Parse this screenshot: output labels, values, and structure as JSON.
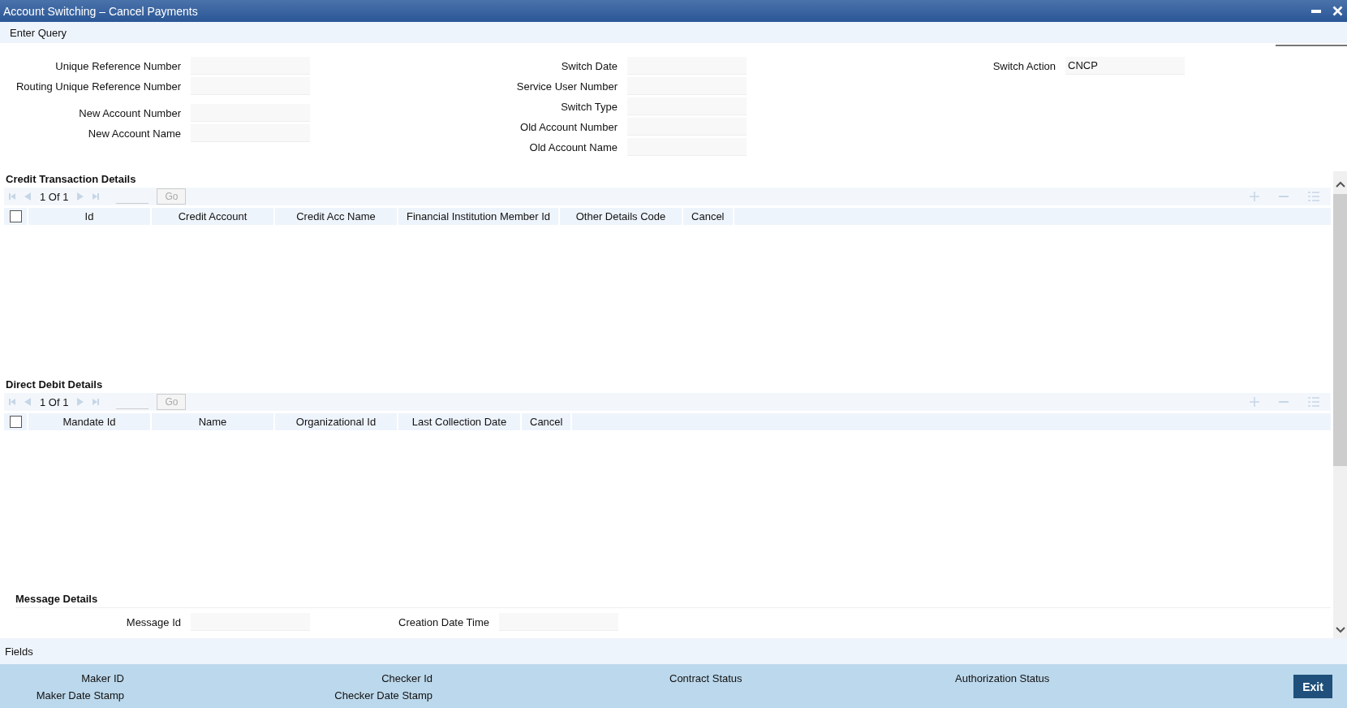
{
  "window": {
    "title": "Account Switching – Cancel Payments"
  },
  "menu": [
    {
      "label": "Enter Query"
    }
  ],
  "form": [
    [
      {
        "label": "Unique Reference Number"
      },
      {
        "label": "Routing Unique Reference Number"
      },
      {
        "label": "New Account Number"
      },
      {
        "label": "New Account Name"
      }
    ],
    [
      {
        "label": "Switch Date"
      },
      {
        "label": "Service User Number"
      },
      {
        "label": "Switch Type"
      },
      {
        "label": "Old Account Number"
      },
      {
        "label": "Old Account Name"
      }
    ],
    [
      {
        "label": "Switch Action",
        "value": "CNCP"
      }
    ]
  ],
  "grids": [
    {
      "title": "Credit Transaction Details",
      "pager": "1 Of 1",
      "go": "Go",
      "select_all": false,
      "columns": [
        "Id",
        "Credit Account",
        "Credit Acc Name",
        "Financial Institution Member Id",
        "Other Details Code",
        "Cancel"
      ]
    },
    {
      "title": "Direct Debit Details",
      "pager": "1 Of 1",
      "go": "Go",
      "select_all": false,
      "columns": [
        "Mandate Id",
        "Name",
        "Organizational Id",
        "Last Collection Date",
        "Cancel"
      ]
    }
  ],
  "message_details": {
    "title": "Message Details",
    "fields": [
      {
        "label": "Message Id"
      },
      {
        "label": "Creation Date Time"
      }
    ]
  },
  "fields_bar": {
    "label": "Fields"
  },
  "audit": [
    [
      "Maker ID",
      "Maker Date Stamp"
    ],
    [
      "Checker Id",
      "Checker Date Stamp"
    ],
    [
      "Contract Status"
    ],
    [
      "Authorization Status"
    ]
  ],
  "exit_button": "Exit"
}
